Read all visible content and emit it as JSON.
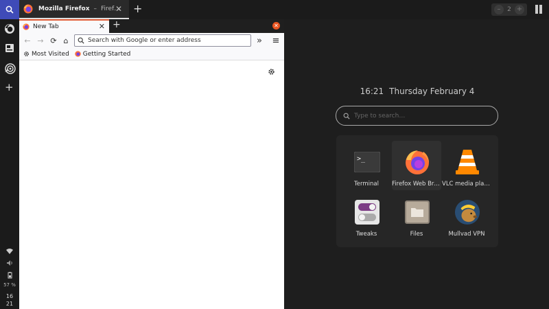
{
  "topbar": {
    "window_title": "Mozilla Firefox",
    "window_subtitle": "Firef…",
    "separator": "–",
    "close_glyph": "✕",
    "new_window_glyph": "+",
    "workspace_minus": "–",
    "workspace_number": "2",
    "workspace_plus": "+",
    "search_icon": "search-icon",
    "tile_icon": "tile-layout-icon"
  },
  "dock": {
    "items": [
      "firefox-icon",
      "software-updater-icon",
      "targeting-icon"
    ],
    "add_glyph": "+",
    "battery": "57 %",
    "clock_hour": "16",
    "clock_min": "21"
  },
  "firefox": {
    "tab_title": "New Tab",
    "tab_close": "✕",
    "new_tab": "+",
    "close_window": "✕",
    "url_placeholder": "Search with Google or enter address",
    "bookmarks": [
      {
        "label": "Most Visited",
        "icon": "gear-icon"
      },
      {
        "label": "Getting Started",
        "icon": "firefox-icon"
      }
    ],
    "nav": {
      "back": "←",
      "forward": "→",
      "reload": "⟳",
      "home": "⌂",
      "overflow": "»",
      "menu": "≡"
    }
  },
  "launcher": {
    "time": "16:21",
    "date": "Thursday February 4",
    "search_placeholder": "Type to search…",
    "apps": [
      {
        "label": "Terminal",
        "icon": "terminal-icon"
      },
      {
        "label": "Firefox Web Browser",
        "icon": "firefox-icon"
      },
      {
        "label": "VLC media player",
        "icon": "vlc-icon"
      },
      {
        "label": "Tweaks",
        "icon": "tweaks-icon"
      },
      {
        "label": "Files",
        "icon": "files-icon"
      },
      {
        "label": "Mullvad VPN",
        "icon": "mullvad-icon"
      }
    ],
    "colors": {
      "accent": "#e95420",
      "search_btn": "#3f4bb8"
    }
  }
}
